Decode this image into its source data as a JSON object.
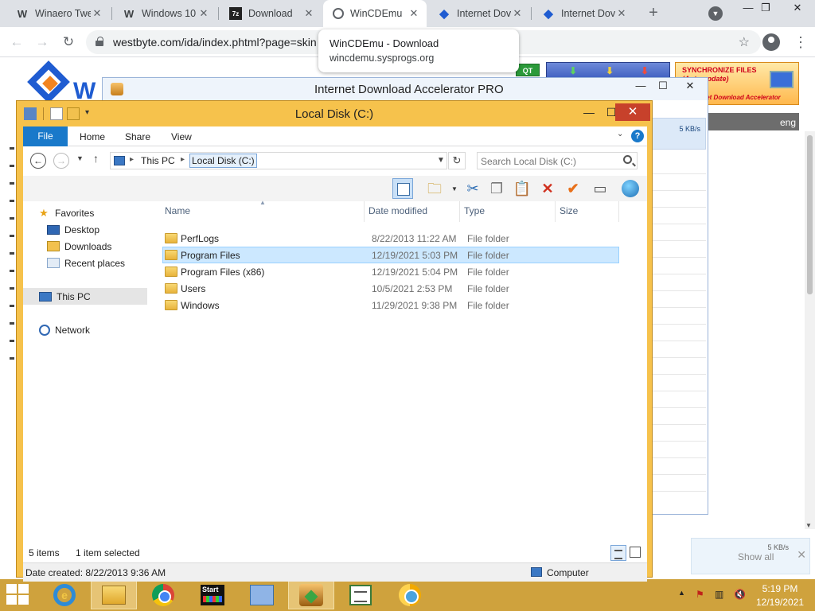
{
  "browser": {
    "tabs": [
      {
        "icon": "W",
        "title": "Winaero Twe",
        "color": "#000000"
      },
      {
        "icon": "W",
        "title": "Windows 10",
        "color": "#000000"
      },
      {
        "icon": "7z",
        "title": "Download",
        "color": "#000000"
      },
      {
        "icon": "globe",
        "title": "WinCDEmu",
        "color": "#5f6368"
      },
      {
        "icon": "ida",
        "title": "Internet Dov",
        "color": "#1f5cd1"
      },
      {
        "icon": "ida",
        "title": "Internet Dov",
        "color": "#1f5cd1"
      }
    ],
    "url": "westbyte.com/ida/index.phtml?page=skin",
    "tooltip": {
      "title": "WinCDEmu - Download",
      "url": "wincdemu.sysprogs.org"
    }
  },
  "webpage": {
    "logo_letters": "W",
    "qt": "QT",
    "sync_title": "SYNCHRONIZE FILES",
    "sync_sub": "(Auto update)",
    "sync_brand": "Internet Download Accelerator",
    "lang": "eng"
  },
  "ida": {
    "title": "Internet Download Accelerator PRO",
    "speed": "5 KB/s"
  },
  "explorer": {
    "title": "Local Disk (C:)",
    "ribbon": {
      "file": "File",
      "home": "Home",
      "share": "Share",
      "view": "View",
      "help": "?"
    },
    "address": {
      "root": "This PC",
      "current": "Local Disk (C:)"
    },
    "search_placeholder": "Search Local Disk (C:)",
    "nav": {
      "favorites": "Favorites",
      "desktop": "Desktop",
      "downloads": "Downloads",
      "recent": "Recent places",
      "this_pc": "This PC",
      "network": "Network"
    },
    "columns": {
      "name": "Name",
      "date": "Date modified",
      "type": "Type",
      "size": "Size"
    },
    "files": [
      {
        "name": "PerfLogs",
        "date": "8/22/2013 11:22 AM",
        "type": "File folder",
        "selected": false
      },
      {
        "name": "Program Files",
        "date": "12/19/2021 5:03 PM",
        "type": "File folder",
        "selected": true
      },
      {
        "name": "Program Files (x86)",
        "date": "12/19/2021 5:04 PM",
        "type": "File folder",
        "selected": false
      },
      {
        "name": "Users",
        "date": "10/5/2021 2:53 PM",
        "type": "File folder",
        "selected": false
      },
      {
        "name": "Windows",
        "date": "11/29/2021 9:38 PM",
        "type": "File folder",
        "selected": false
      }
    ],
    "status": {
      "items": "5 items",
      "selected": "1 item selected"
    },
    "info": {
      "date_created": "Date created: 8/22/2013 9:36 AM",
      "computer": "Computer"
    }
  },
  "overlay": {
    "speed": "5 KB/s",
    "show": "Show all"
  },
  "taskbar": {
    "start_app_label": "Start",
    "time": "5:19 PM",
    "date": "12/19/2021"
  },
  "colors": {
    "explorer_frame": "#f6c24c",
    "taskbar": "#cfa23d",
    "selection": "#cce8ff",
    "file_tab": "#1979ca",
    "close_button": "#c7412b"
  }
}
